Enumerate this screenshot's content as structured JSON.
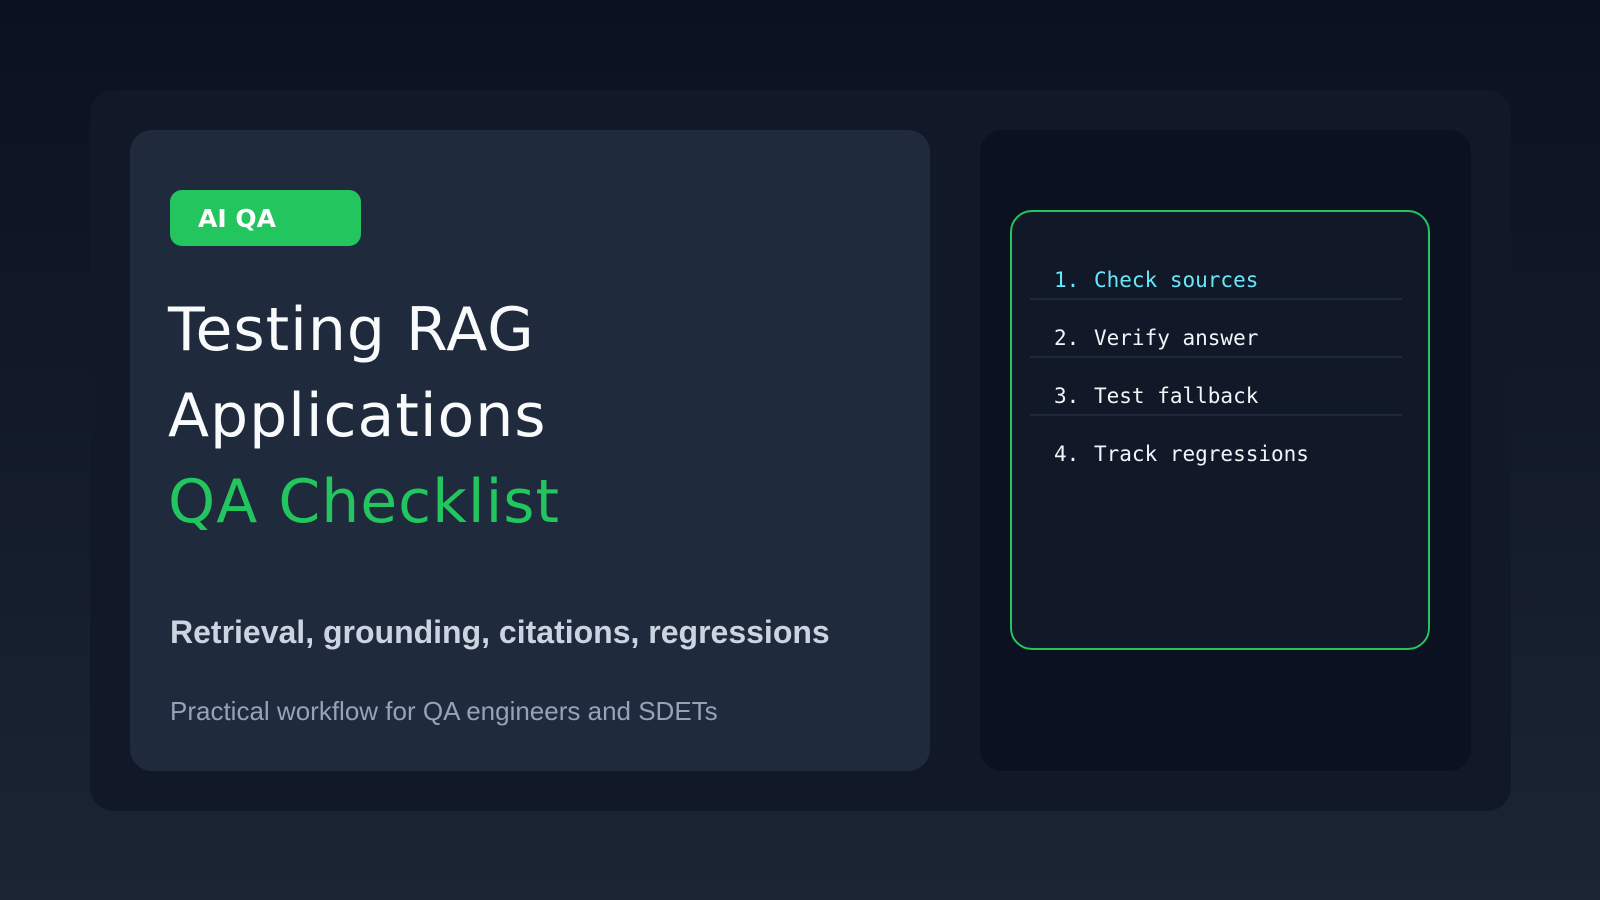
{
  "tag": {
    "label": "AI QA"
  },
  "title": {
    "line1": "Testing RAG",
    "line2": "Applications",
    "line3": "QA Checklist"
  },
  "subtitle": "Retrieval, grounding, citations, regressions",
  "description": "Practical workflow for QA engineers and SDETs",
  "checklist": {
    "items": [
      {
        "number": "1.",
        "label": "Check sources",
        "active": true
      },
      {
        "number": "2.",
        "label": "Verify answer",
        "active": false
      },
      {
        "number": "3.",
        "label": "Test fallback",
        "active": false
      },
      {
        "number": "4.",
        "label": "Track regressions",
        "active": false
      }
    ]
  },
  "colors": {
    "accent": "#22c55e",
    "active_item": "#67e8f9",
    "background": "#0a1120",
    "card": "#1f2a3c"
  }
}
